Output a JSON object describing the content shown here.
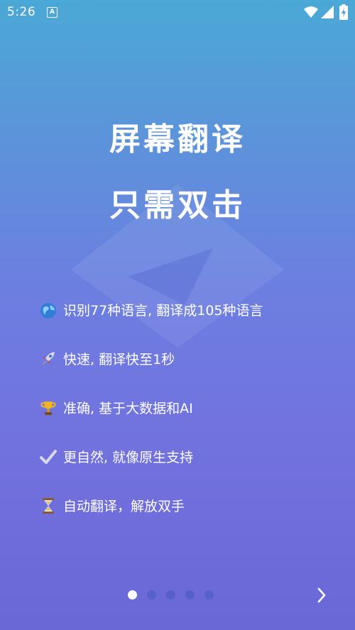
{
  "status_bar": {
    "time": "5:26",
    "notification_icon": "A"
  },
  "headline": {
    "line1": "屏幕翻译",
    "line2": "只需双击"
  },
  "features": [
    {
      "icon": "globe-emoji",
      "text": "识别77种语言, 翻译成105种语言"
    },
    {
      "icon": "rocket-emoji",
      "text": "快速, 翻译快至1秒"
    },
    {
      "icon": "trophy-emoji",
      "text": "准确, 基于大数据和AI"
    },
    {
      "icon": "check-mark-emoji",
      "text": "更自然, 就像原生支持"
    },
    {
      "icon": "hourglass-emoji",
      "text": "自动翻译，解放双手"
    }
  ],
  "pager": {
    "total": 5,
    "active": 1
  },
  "colors": {
    "gradient_top": "#4aa9d6",
    "gradient_bottom": "#6a67d6",
    "text": "#ffffff"
  }
}
